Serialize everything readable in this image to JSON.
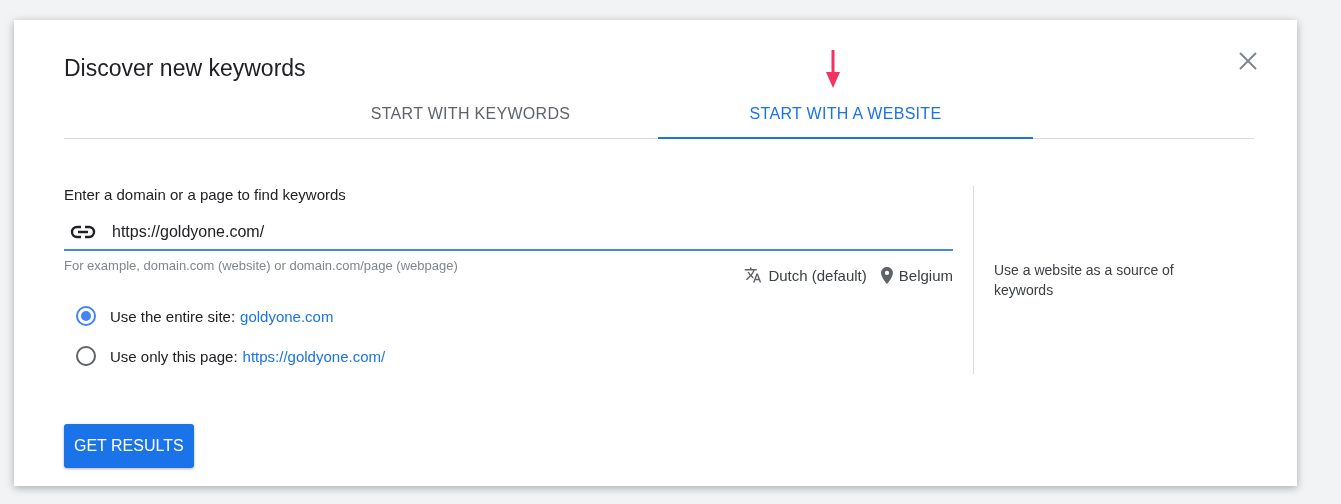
{
  "dialog": {
    "title": "Discover new keywords"
  },
  "tabs": [
    {
      "label": "START WITH KEYWORDS",
      "selected": false
    },
    {
      "label": "START WITH A WEBSITE",
      "selected": true
    }
  ],
  "url_field": {
    "label": "Enter a domain or a page to find keywords",
    "value": "https://goldyone.com/",
    "hint": "For example, domain.com (website) or domain.com/page (webpage)"
  },
  "language": "Dutch (default)",
  "location": "Belgium",
  "scope_options": [
    {
      "label": "Use the entire site:",
      "link": "goldyone.com",
      "selected": true
    },
    {
      "label": "Use only this page:",
      "link": "https://goldyone.com/",
      "selected": false
    }
  ],
  "side_note": "Use a website as a source of keywords",
  "primary_button": "GET RESULTS"
}
